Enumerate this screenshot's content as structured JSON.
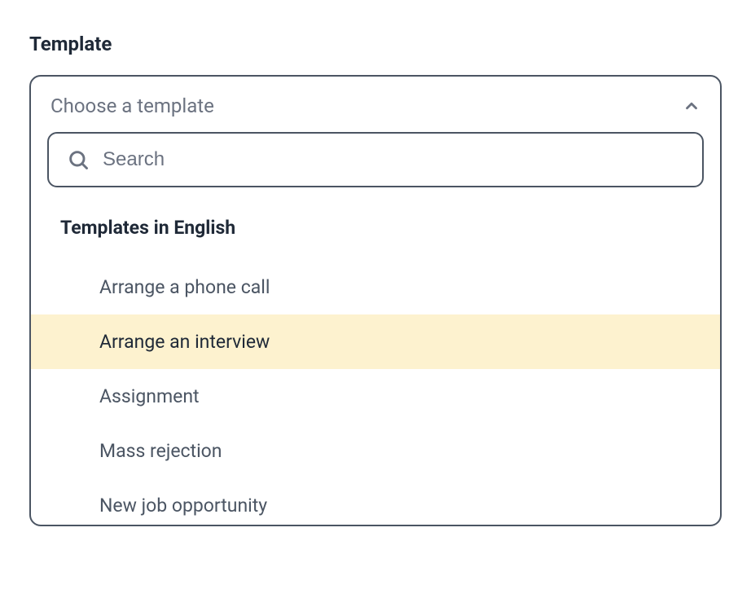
{
  "field": {
    "label": "Template"
  },
  "dropdown": {
    "placeholder": "Choose a template",
    "search_placeholder": "Search",
    "group_header": "Templates in English",
    "options": [
      {
        "label": "Arrange a phone call",
        "highlighted": false
      },
      {
        "label": "Arrange an interview",
        "highlighted": true
      },
      {
        "label": "Assignment",
        "highlighted": false
      },
      {
        "label": "Mass rejection",
        "highlighted": false
      },
      {
        "label": "New job opportunity",
        "highlighted": false
      }
    ]
  }
}
